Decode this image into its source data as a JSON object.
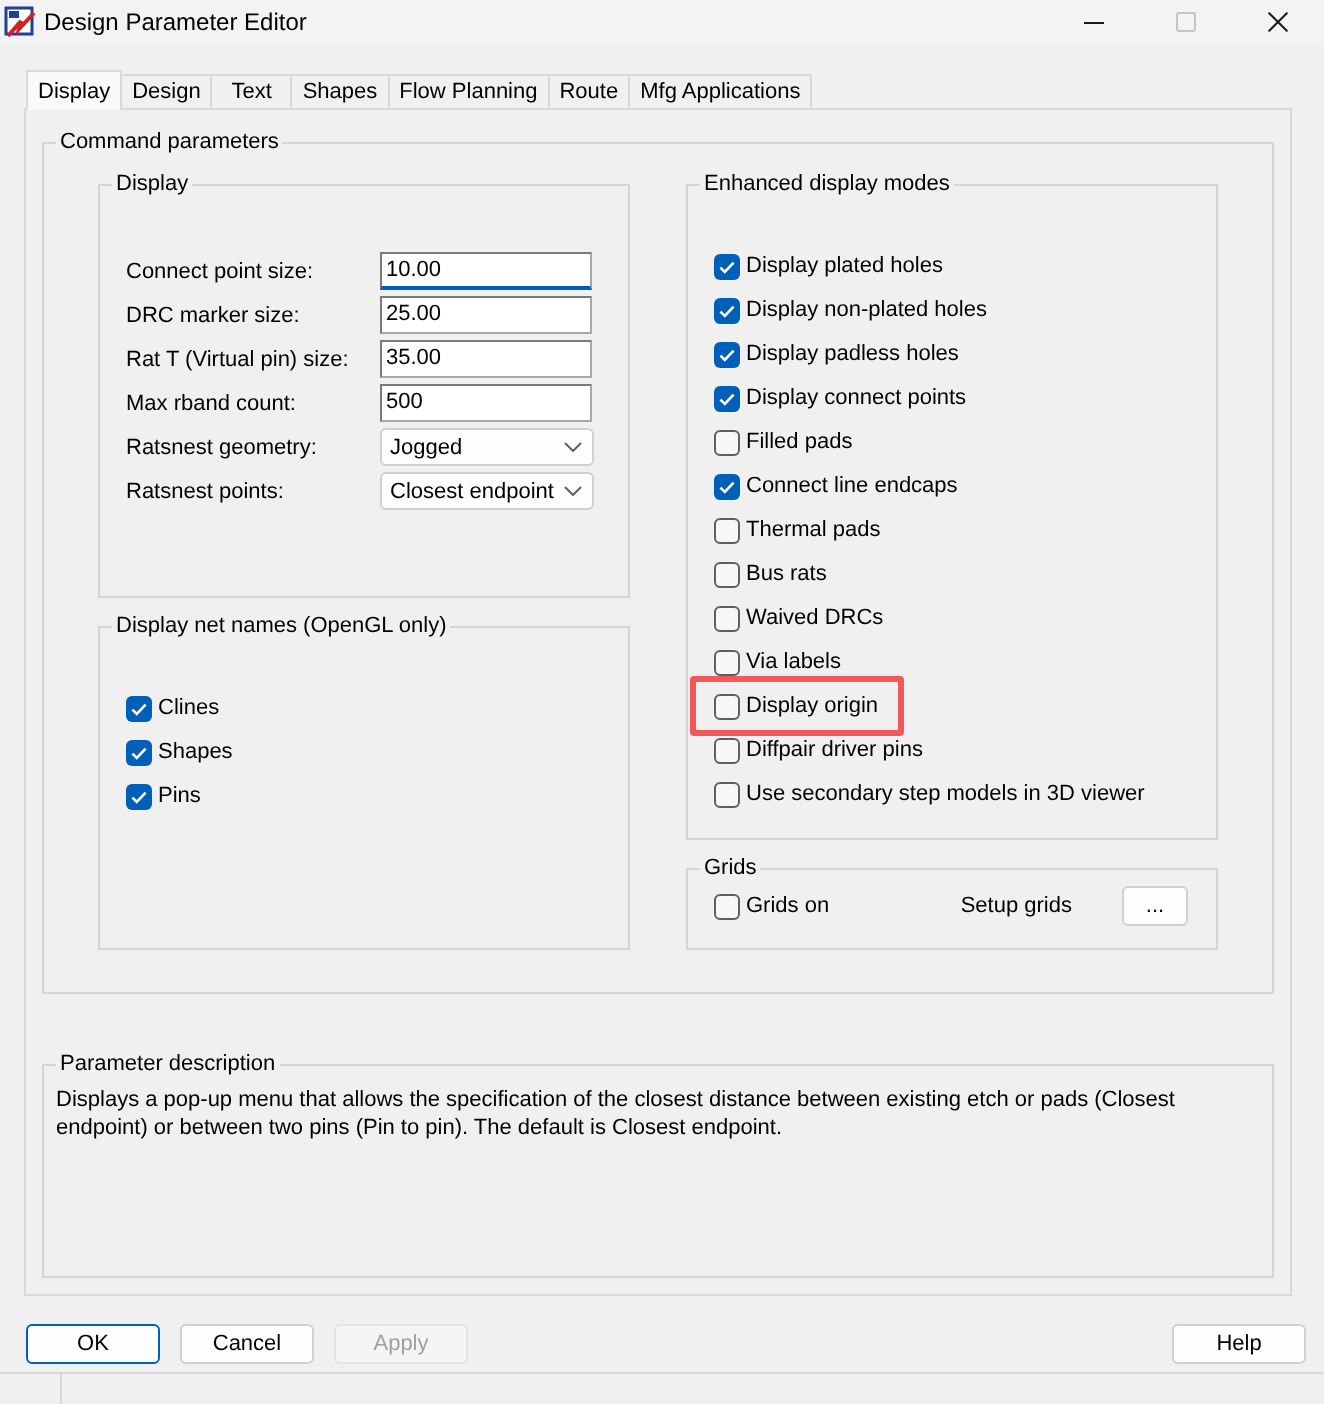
{
  "window": {
    "title": "Design Parameter Editor",
    "controls": [
      {
        "kind": "minimize",
        "disabled": false
      },
      {
        "kind": "maximize",
        "disabled": true
      },
      {
        "kind": "close",
        "disabled": false
      }
    ]
  },
  "tabs": [
    {
      "label": "Display",
      "selected": true
    },
    {
      "label": "Design",
      "selected": false
    },
    {
      "label": "Text",
      "selected": false
    },
    {
      "label": "Shapes",
      "selected": false
    },
    {
      "label": "Flow Planning",
      "selected": false
    },
    {
      "label": "Route",
      "selected": false
    },
    {
      "label": "Mfg Applications",
      "selected": false
    }
  ],
  "command_parameters": {
    "title": "Command parameters",
    "display": {
      "title": "Display",
      "fields": [
        {
          "kind": "text",
          "label": "Connect point size:",
          "value": "10.00",
          "focused": true
        },
        {
          "kind": "text",
          "label": "DRC marker size:",
          "value": "25.00",
          "focused": false
        },
        {
          "kind": "text",
          "label": "Rat T (Virtual pin) size:",
          "value": "35.00",
          "focused": false
        },
        {
          "kind": "text",
          "label": "Max rband count:",
          "value": "500",
          "focused": false
        },
        {
          "kind": "dropdown",
          "label": "Ratsnest geometry:",
          "value": "Jogged",
          "focused": false
        },
        {
          "kind": "dropdown",
          "label": "Ratsnest points:",
          "value": "Closest endpoint",
          "focused": false
        }
      ]
    },
    "net_names": {
      "title": "Display net names (OpenGL only)",
      "items": [
        {
          "label": "Clines",
          "checked": true
        },
        {
          "label": "Shapes",
          "checked": true
        },
        {
          "label": "Pins",
          "checked": true
        }
      ]
    },
    "enhanced_display_modes": {
      "title": "Enhanced display modes",
      "items": [
        {
          "label": "Display plated holes",
          "checked": true,
          "highlighted": false
        },
        {
          "label": "Display non-plated holes",
          "checked": true,
          "highlighted": false
        },
        {
          "label": "Display padless holes",
          "checked": true,
          "highlighted": false
        },
        {
          "label": "Display connect points",
          "checked": true,
          "highlighted": false
        },
        {
          "label": "Filled pads",
          "checked": false,
          "highlighted": false
        },
        {
          "label": "Connect line endcaps",
          "checked": true,
          "highlighted": false
        },
        {
          "label": "Thermal pads",
          "checked": false,
          "highlighted": false
        },
        {
          "label": "Bus rats",
          "checked": false,
          "highlighted": false
        },
        {
          "label": "Waived DRCs",
          "checked": false,
          "highlighted": false
        },
        {
          "label": "Via labels",
          "checked": false,
          "highlighted": false
        },
        {
          "label": "Display origin",
          "checked": false,
          "highlighted": true
        },
        {
          "label": "Diffpair driver pins",
          "checked": false,
          "highlighted": false
        },
        {
          "label": "Use secondary step models in 3D viewer",
          "checked": false,
          "highlighted": false
        }
      ]
    },
    "grids": {
      "title": "Grids",
      "grids_on": {
        "label": "Grids on",
        "checked": false
      },
      "setup_label": "Setup grids",
      "setup_button": "..."
    }
  },
  "parameter_description": {
    "title": "Parameter description",
    "text": "Displays a pop-up menu that allows the specification of the closest distance between existing etch or pads (Closest endpoint) or between two pins (Pin to pin). The default is Closest endpoint."
  },
  "buttons": [
    {
      "label": "OK",
      "default": true,
      "disabled": false
    },
    {
      "label": "Cancel",
      "default": false,
      "disabled": false
    },
    {
      "label": "Apply",
      "default": false,
      "disabled": true
    }
  ],
  "help_button": {
    "label": "Help"
  }
}
